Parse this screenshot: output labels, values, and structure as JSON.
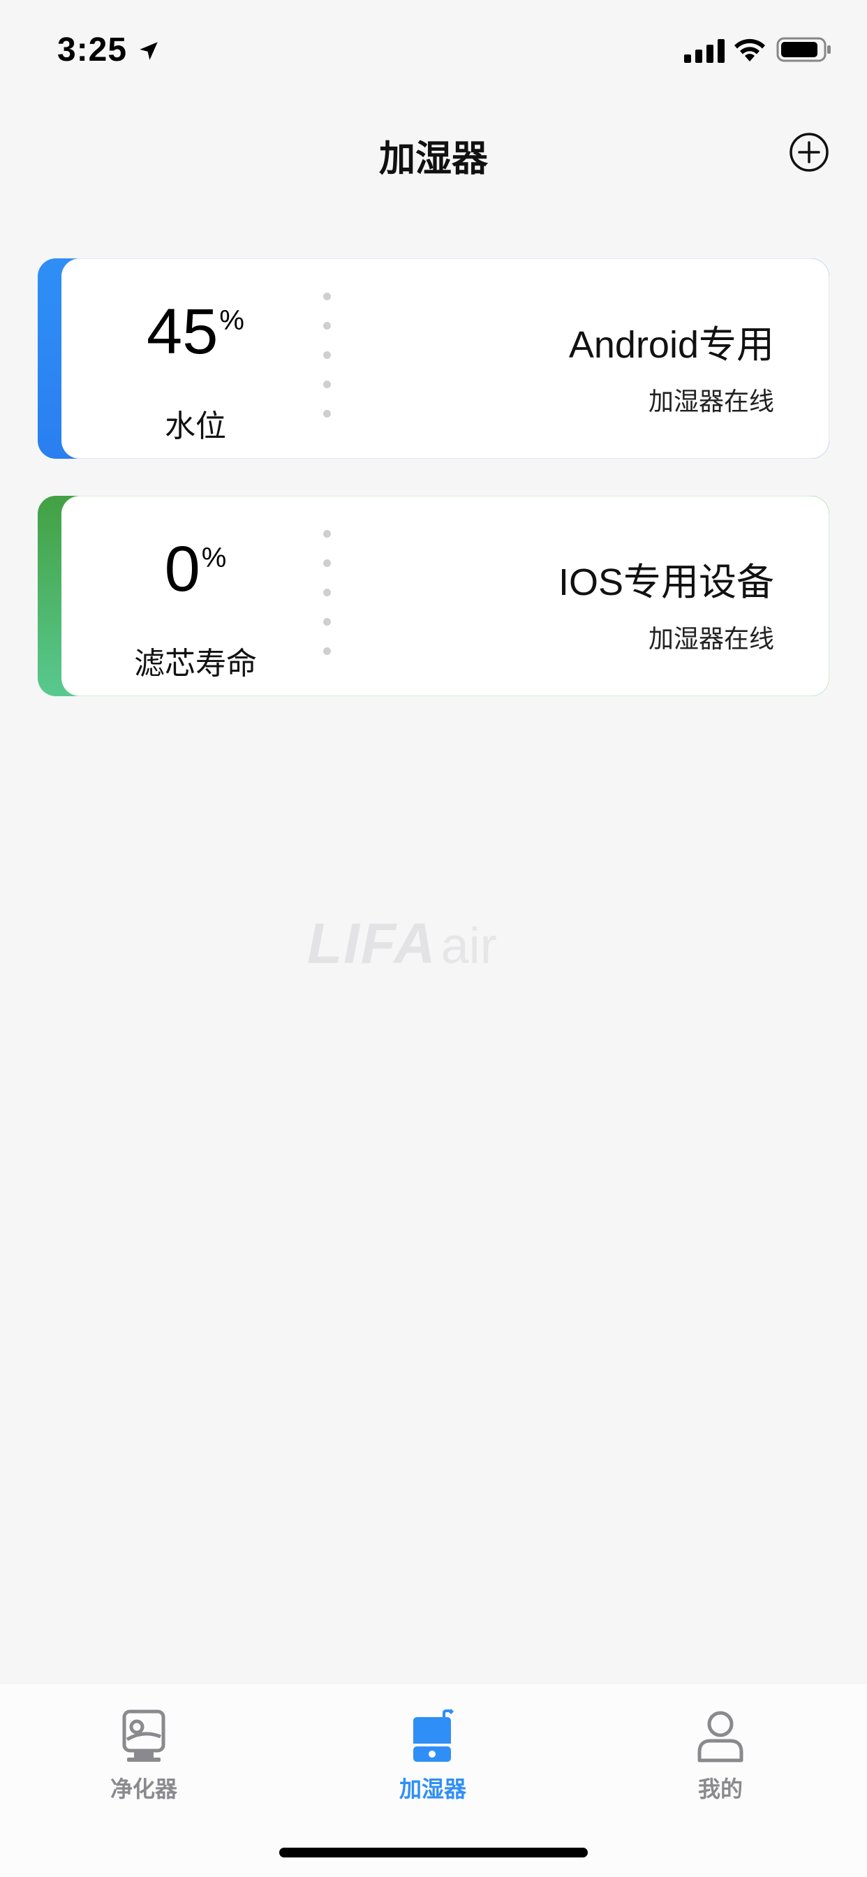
{
  "status_bar": {
    "time": "3:25",
    "icons": [
      "location-arrow-icon",
      "cellular-signal-icon",
      "wifi-icon",
      "battery-icon"
    ]
  },
  "nav": {
    "title": "加湿器",
    "add_icon": "plus-circle-icon"
  },
  "cards": [
    {
      "metric_value": "45",
      "metric_unit": "%",
      "metric_label": "水位",
      "device_name": "Android专用",
      "device_status": "加湿器在线",
      "accent_color": "#2f8ff6"
    },
    {
      "metric_value": "0",
      "metric_unit": "%",
      "metric_label": "滤芯寿命",
      "device_name": "IOS专用设备",
      "device_status": "加湿器在线",
      "accent_color": "#4cb46a"
    }
  ],
  "watermark": {
    "brand": "LIFA",
    "suffix": "air"
  },
  "tab_bar": {
    "active_index": 1,
    "active_color": "#2f8ff6",
    "inactive_color": "#8a8a8e",
    "tabs": [
      {
        "label": "净化器",
        "icon": "purifier-icon"
      },
      {
        "label": "加湿器",
        "icon": "humidifier-icon"
      },
      {
        "label": "我的",
        "icon": "user-icon"
      }
    ]
  }
}
